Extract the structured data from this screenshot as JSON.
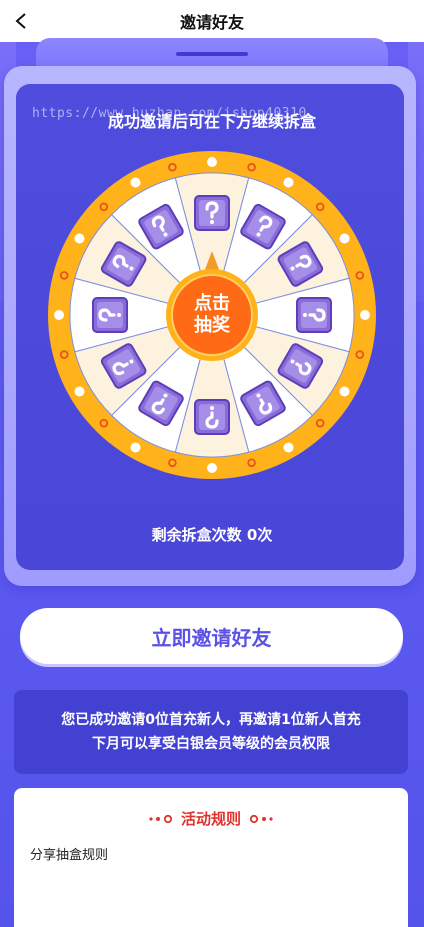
{
  "nav": {
    "title": "邀请好友",
    "back_icon": "chevron-left-icon"
  },
  "box": {
    "heading": "成功邀请后可在下方继续拆盒",
    "watermark": "https://www.huzhan.com/ishop40310",
    "spin_button_line1": "点击",
    "spin_button_line2": "抽奖",
    "remaining_text": "剩余拆盒次数 0次",
    "wheel_segments": 12,
    "prize_icon": "mystery-box-icon",
    "colors": {
      "ring": "#ffb21a",
      "spinner": "#ff6a14",
      "cell_a": "#fdf2dd",
      "cell_b": "#ffffff",
      "prize": "#8a6bd9"
    }
  },
  "invite_button": {
    "label": "立即邀请好友"
  },
  "info": {
    "line1": "您已成功邀请0位首充新人，再邀请1位新人首充",
    "line2": "下月可以享受白银会员等级的会员权限"
  },
  "rules": {
    "title": "活动规则",
    "subtitle": "分享抽盒规则",
    "accent": "#e0332d"
  }
}
